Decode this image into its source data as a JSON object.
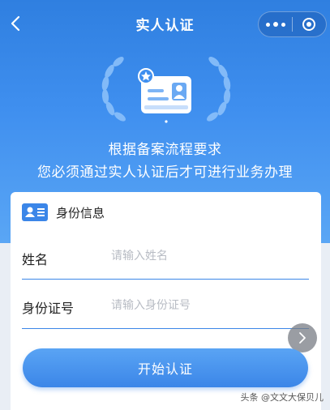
{
  "navbar": {
    "title": "实人认证",
    "back_icon": "chevron-left-icon",
    "more_icon": "more-dots-icon",
    "close_icon": "target-circle-icon"
  },
  "hero": {
    "line1": "根据备案流程要求",
    "line2": "您必须通过实人认证后才可进行业务办理"
  },
  "form": {
    "section_title": "身份信息",
    "name_label": "姓名",
    "name_placeholder": "请输入姓名",
    "id_label": "身份证号",
    "id_placeholder": "请输入身份证号",
    "submit_label": "开始认证"
  },
  "watermark": "头条 @文文大保贝儿",
  "colors": {
    "primary": "#3b86e8",
    "hero_top": "#2f7fe0",
    "hero_bottom": "#5aa6f5",
    "background": "#e9eef5"
  }
}
